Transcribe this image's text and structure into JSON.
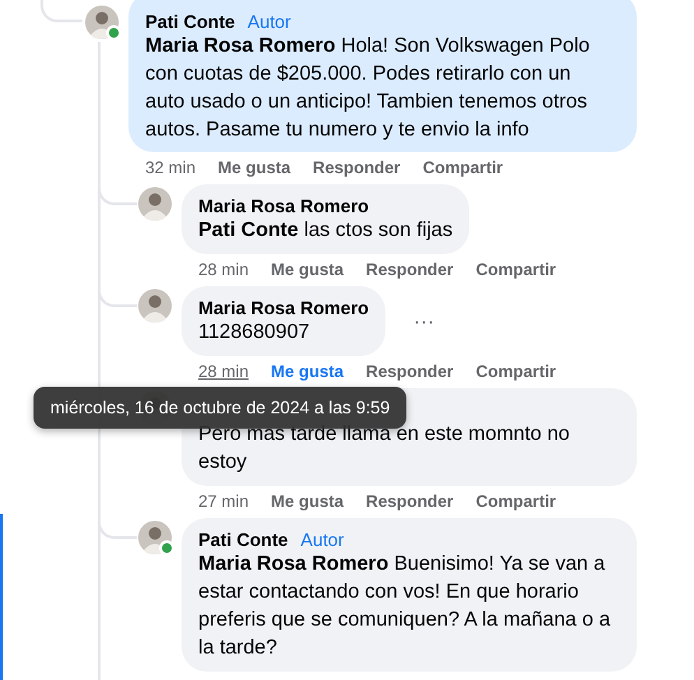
{
  "comments": [
    {
      "author": "Pati Conte",
      "badge": "Autor",
      "online": true,
      "highlighted": true,
      "text": "**Maria Rosa Romero** Hola! Son Volkswagen Polo con cuotas de $205.000. Podes retirarlo con un auto usado o un anticipo! Tambien tenemos otros autos. Pasame tu numero y te envio la info",
      "time": "32 min",
      "time_hovered": false,
      "like": "Me gusta",
      "liked": false,
      "reply": "Responder",
      "share": "Compartir",
      "children": [
        {
          "author": "Maria Rosa Romero",
          "online": false,
          "highlighted": false,
          "text": "**Pati Conte** las ctos son fijas",
          "time": "28 min",
          "time_hovered": false,
          "like": "Me gusta",
          "liked": false,
          "reply": "Responder",
          "share": "Compartir"
        },
        {
          "author": "Maria Rosa Romero",
          "online": false,
          "highlighted": false,
          "text": "1128680907",
          "more_label": "···",
          "time": "28 min",
          "time_hovered": true,
          "like": "Me gusta",
          "liked": true,
          "reply": "Responder",
          "share": "Compartir"
        },
        {
          "online": false,
          "highlighted": false,
          "text": "Pero mas tarde llama en este momnto no estoy",
          "time": "27 min",
          "time_hovered": false,
          "like": "Me gusta",
          "liked": false,
          "reply": "Responder",
          "share": "Compartir"
        },
        {
          "author": "Pati Conte",
          "badge": "Autor",
          "online": true,
          "highlighted": false,
          "text": "**Maria Rosa Romero** Buenisimo! Ya se van a estar contactando con vos! En que horario preferis que se comuniquen? A la mañana o a la tarde?"
        }
      ]
    }
  ],
  "tooltip": "miércoles, 16 de octubre de 2024 a las 9:59"
}
